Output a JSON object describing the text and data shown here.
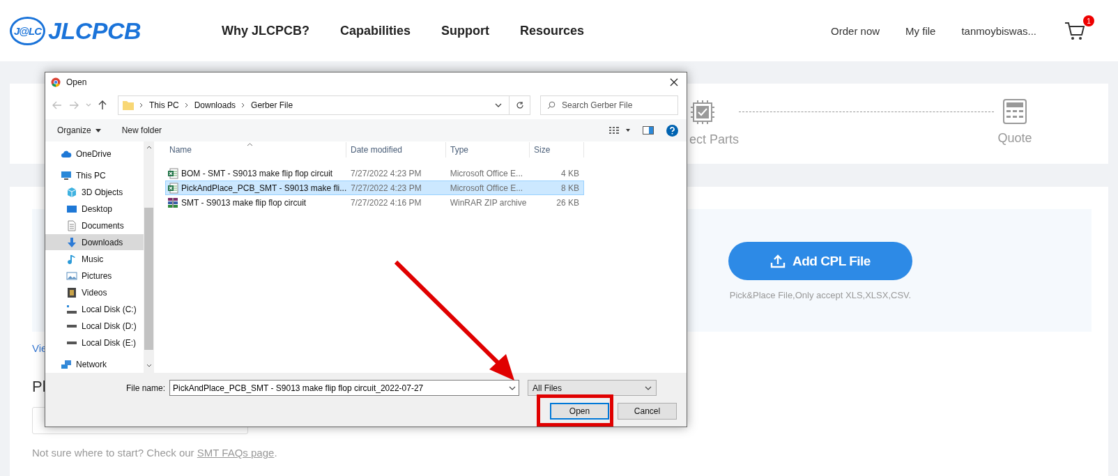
{
  "header": {
    "logo_badge": "J@LC",
    "logo": "JLCPCB",
    "nav": [
      "Why JLCPCB?",
      "Capabilities",
      "Support",
      "Resources"
    ],
    "links": [
      "Order now",
      "My file",
      "tanmoybiswas..."
    ],
    "cart_count": "1"
  },
  "steps": [
    {
      "kind": "parts",
      "label": "ect Parts"
    },
    {
      "kind": "quote",
      "label": "Quote"
    }
  ],
  "upload": {
    "button": "Add CPL File",
    "hint": "Pick&Place File,Only accept XLS,XLSX,CSV."
  },
  "view_link": "Vie",
  "heading": "Pl",
  "footer": {
    "text": "Not sure where to start? Check our ",
    "link": "SMT FAQs page",
    "end": "."
  },
  "dialog": {
    "title": "Open",
    "path": [
      "This PC",
      "Downloads",
      "Gerber File"
    ],
    "search": {
      "placeholder": "Search Gerber File"
    },
    "toolbar": [
      "Organize",
      "New folder"
    ],
    "nav": [
      {
        "kind": "cloud",
        "label": "OneDrive",
        "selected": false
      },
      {
        "kind": "pc",
        "label": "This PC",
        "selected": false
      },
      {
        "kind": "cube",
        "label": "3D Objects",
        "selected": false
      },
      {
        "kind": "desktop",
        "label": "Desktop",
        "selected": false
      },
      {
        "kind": "document",
        "label": "Documents",
        "selected": false
      },
      {
        "kind": "download",
        "label": "Downloads",
        "selected": true
      },
      {
        "kind": "music",
        "label": "Music",
        "selected": false
      },
      {
        "kind": "pictures",
        "label": "Pictures",
        "selected": false
      },
      {
        "kind": "video",
        "label": "Videos",
        "selected": false
      },
      {
        "kind": "system-disk",
        "label": "Local Disk (C:)",
        "selected": false
      },
      {
        "kind": "disk",
        "label": "Local Disk (D:)",
        "selected": false
      },
      {
        "kind": "disk",
        "label": "Local Disk (E:)",
        "selected": false
      },
      {
        "kind": "network",
        "label": "Network",
        "selected": false
      }
    ],
    "columns": [
      "Name",
      "Date modified",
      "Type",
      "Size"
    ],
    "rows": [
      {
        "kind": "spreadsheet",
        "name": "BOM - SMT - S9013 make flip flop circuit",
        "date": "7/27/2022 4:23 PM",
        "type": "Microsoft Office E...",
        "size": "4 KB",
        "selected": false
      },
      {
        "kind": "spreadsheet",
        "name": "PickAndPlace_PCB_SMT - S9013 make fli...",
        "date": "7/27/2022 4:23 PM",
        "type": "Microsoft Office E...",
        "size": "8 KB",
        "selected": true
      },
      {
        "kind": "archive",
        "name": "SMT - S9013 make flip flop circuit",
        "date": "7/27/2022 4:16 PM",
        "type": "WinRAR ZIP archive",
        "size": "26 KB",
        "selected": false
      }
    ],
    "file_name_label": "File name:",
    "file_name": "PickAndPlace_PCB_SMT - S9013 make flip flop circuit_2022-07-27",
    "filter": "All Files",
    "buttons": [
      {
        "label": "Open",
        "default": true
      },
      {
        "label": "Cancel",
        "default": false
      }
    ]
  },
  "annotation": {
    "arrow": true,
    "highlight_box": true
  }
}
